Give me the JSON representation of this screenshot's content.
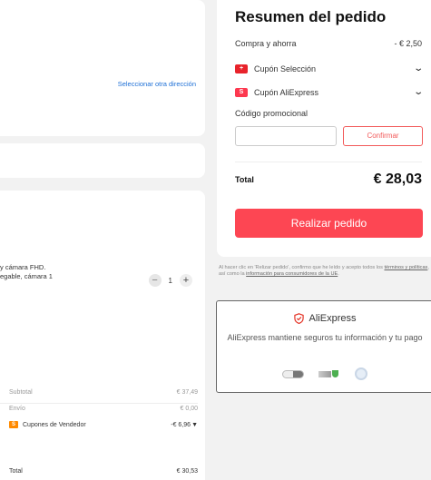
{
  "address": {
    "change_link": "Seleccionar otra dirección"
  },
  "product": {
    "title_line1": "y cámara FHD.",
    "title_line2": "egable, cámara 1",
    "quantity": "1",
    "minus": "−",
    "plus": "+"
  },
  "store_summary": {
    "subtotal_label": "Subtotal",
    "subtotal_value": "€ 37,49",
    "shipping_label": "Envío",
    "shipping_value": "€ 0,00",
    "coupon_label": "Cupones de Vendedor",
    "coupon_value": "-€ 6,96",
    "total_label": "Total",
    "total_value": "€ 30,53"
  },
  "summary": {
    "title": "Resumen del pedido",
    "buy_save_label": "Compra y ahorra",
    "buy_save_value": "- € 2,50",
    "coupon_selection": "Cupón Selección",
    "coupon_aliexpress": "Cupón AliExpress",
    "promo_label": "Código promocional",
    "promo_placeholder": "",
    "confirm_button": "Confirmar",
    "total_label": "Total",
    "total_value": "€ 28,03",
    "order_button": "Realizar pedido"
  },
  "legal": {
    "prefix": "Al hacer clic en 'Relizar pedido', confirmo que he leído y acepto todos los ",
    "terms_link": "términos y políticas",
    "middle": ", así como la ",
    "info_link": "información para consumidores de la UE",
    "suffix": "."
  },
  "secure_box": {
    "brand": "AliExpress",
    "text": "AliExpress mantiene seguros tu información y tu pago"
  },
  "icons": {
    "coupon_badge": "S",
    "selection_badge": "+",
    "chevron": "chevron-down-icon",
    "shield": "shield-icon"
  },
  "colors": {
    "accent": "#fd4653",
    "link": "#1d6fd6",
    "coupon_orange": "#ff8a00"
  }
}
